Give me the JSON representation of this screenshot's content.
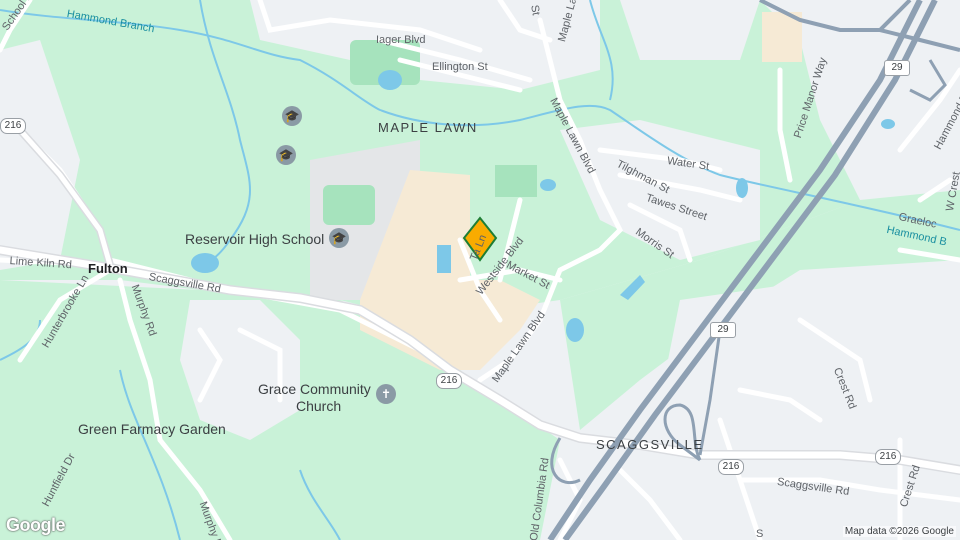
{
  "colors": {
    "park": "#c9f2d8",
    "base": "#eef1f4",
    "road": "#ffffff",
    "highway": "#8ea0b3",
    "commercial": "#f6ead5",
    "water": "#7dc8e8",
    "school_grounds": "#e8e8e8",
    "marker": "#f9ab00"
  },
  "areas": {
    "maple_lawn": "MAPLE LAWN",
    "fulton": "Fulton",
    "scaggsville": "SCAGGSVILLE"
  },
  "water_labels": {
    "hammond_branch_top": "Hammond Branch",
    "hammond_branch_right": "Hammond B"
  },
  "streets": {
    "school_rd": "School Rd",
    "iager_blvd": "Iager Blvd",
    "ellington_st": "Ellington St",
    "maple_la_top": "Maple La",
    "st_top": "St",
    "maple_lawn_blvd_north": "Maple Lawn Blvd",
    "water_st": "Water St",
    "tilghman_st": "Tilghman St",
    "tawes_street": "Tawes Street",
    "morris_st": "Morris St",
    "price_manor_way": "Price Manor Way",
    "hammond_pkwy": "Hammond Pkwy",
    "w_crest": "W Crest",
    "graelo": "Graeloc",
    "lime_kiln_rd": "Lime Kiln Rd",
    "scaggsville_rd": "Scaggsville Rd",
    "hunterbrooke_ln": "Hunterbrooke Ln",
    "murphy_rd": "Murphy Rd",
    "westside_blvd": "Westside Blvd",
    "market_st": "Market St",
    "maple_lawn_blvd_south": "Maple Lawn Blvd",
    "ta_ln": "Ta   Ln",
    "crest_rd": "Crest Rd",
    "crest_rd_2": "Crest Rd",
    "scaggsville_rd_east": "Scaggsville Rd",
    "old_columbia_rd": "Old Columbia Rd",
    "huntfield_dr": "Huntfield Dr",
    "murphy_r_south": "Murphy R",
    "s_edge": "S"
  },
  "pois": {
    "reservoir_high_school": "Reservoir High School",
    "grace_community_church_line1": "Grace Community",
    "grace_community_church_line2": "Church",
    "green_farmacy_garden": "Green Farmacy Garden"
  },
  "shields": {
    "md216_west": "216",
    "md216_center": "216",
    "md216_east": "216",
    "md216_far_east": "216",
    "us29_north": "29",
    "us29_south": "29"
  },
  "icons": {
    "school": "graduation-cap-icon",
    "church": "cross-icon",
    "marker": "location-pin-icon"
  },
  "branding": {
    "logo": "Google",
    "attribution": "Map data ©2026 Google"
  }
}
